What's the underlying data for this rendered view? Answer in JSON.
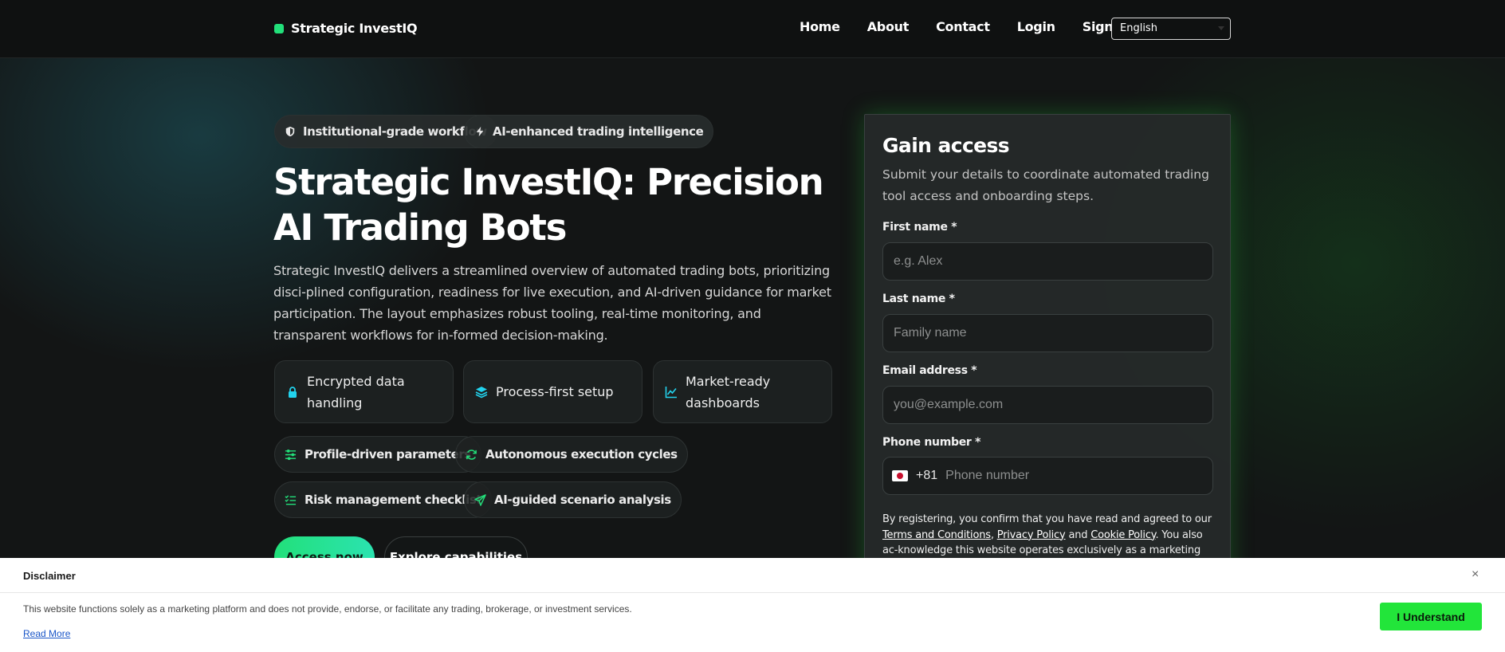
{
  "header": {
    "brand": "Strategic InvestIQ",
    "nav": [
      "Home",
      "About",
      "Contact",
      "Login",
      "Sign Up"
    ],
    "language": "English"
  },
  "hero": {
    "pills": [
      "Institutional-grade workflow",
      "AI-enhanced trading intelligence"
    ],
    "title": "Strategic InvestIQ: Precision AI Trading Bots",
    "description": "Strategic InvestIQ delivers a streamlined overview of automated trading bots, prioritizing disci-plined configuration, readiness for live execution, and AI-driven guidance for market participation. The layout emphasizes robust tooling, real-time monitoring, and transparent workflows for in-formed decision-making.",
    "cards": [
      "Encrypted data handling",
      "Process-first setup",
      "Market-ready dashboards"
    ],
    "chips": [
      "Profile-driven parameters",
      "Autonomous execution cycles",
      "Risk management checklist",
      "AI-guided scenario analysis"
    ],
    "access_button": "Access now",
    "explore_button": "Explore capabilities"
  },
  "form": {
    "title": "Gain access",
    "subtitle": "Submit your details to coordinate automated trading tool access and onboarding steps.",
    "first_name_label": "First name *",
    "first_name_placeholder": "e.g. Alex",
    "last_name_label": "Last name *",
    "last_name_placeholder": "Family name",
    "email_label": "Email address *",
    "email_placeholder": "you@example.com",
    "phone_label": "Phone number *",
    "phone_code": "+81",
    "phone_placeholder": "Phone number",
    "consent_prefix": "By registering, you confirm that you have read and agreed to our",
    "terms": "Terms and Conditions",
    "privacy": "Privacy Policy",
    "and": "and",
    "cookie": "Cookie Policy",
    "consent_suffix": ". You also ac-knowledge this website operates exclusively as a marketing plat-"
  },
  "disclaimer": {
    "title": "Disclaimer",
    "text": "This website functions solely as a marketing platform and does not provide, endorse, or facilitate any trading, brokerage, or investment services.",
    "read_more": "Read More",
    "button": "I Understand",
    "close": "×"
  },
  "colors": {
    "accent_green": "#22e07a",
    "icon_cyan": "#22d3ee",
    "button_green": "#22e53a",
    "background": "#131515"
  },
  "icons": [
    "shield-icon",
    "bolt-icon",
    "lock-icon",
    "layers-icon",
    "chart-icon",
    "sliders-icon",
    "refresh-icon",
    "checklist-icon",
    "send-icon",
    "japan-flag-icon",
    "close-icon"
  ]
}
